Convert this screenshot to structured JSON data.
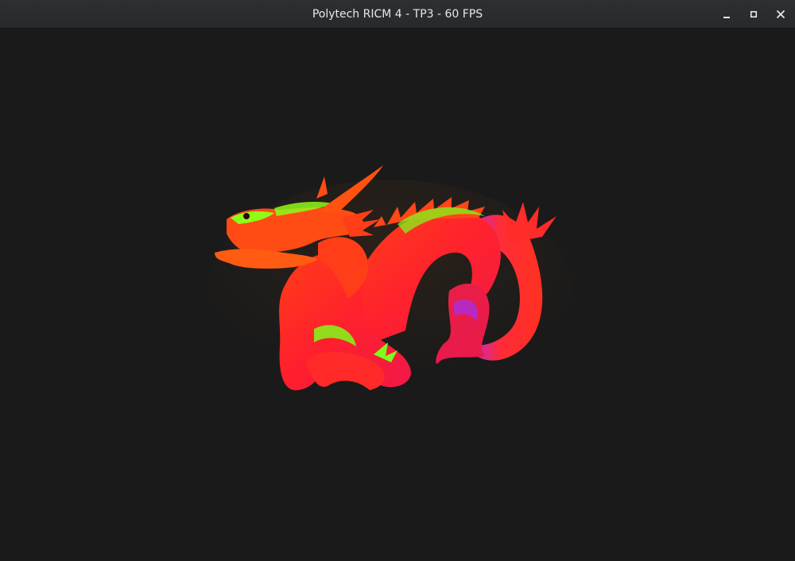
{
  "window": {
    "title": "Polytech RICM 4 - TP3 - 60 FPS"
  },
  "controls": {
    "minimize": "minimize-icon",
    "maximize": "maximize-icon",
    "close": "close-icon"
  },
  "scene": {
    "background": "#1a1a1a",
    "model": "dragon",
    "shading": "normal-map",
    "colors": {
      "red": "#ff1e1e",
      "orange": "#ff6a10",
      "green": "#6cff10",
      "magenta": "#c81ee6"
    }
  }
}
